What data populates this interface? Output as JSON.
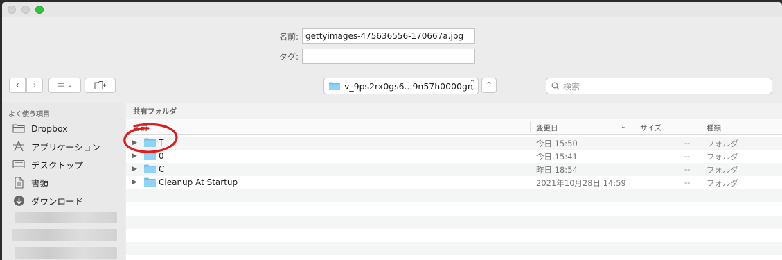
{
  "dialog": {
    "name_label": "名前:",
    "name_value": "gettyimages-475636556-170667a.jpg",
    "tag_label": "タグ:",
    "tag_value": ""
  },
  "toolbar": {
    "back_glyph": "‹",
    "forward_glyph": "›",
    "view_glyph": "≡",
    "view_chevron": "⌄",
    "location": "v_9ps2rx0gs6...9n57h0000gn",
    "collapse_glyph": "⌃",
    "search_placeholder": "検索"
  },
  "sidebar": {
    "heading": "よく使う項目",
    "items": [
      {
        "label": "Dropbox",
        "icon": "folder-icon"
      },
      {
        "label": "アプリケーション",
        "icon": "applications-icon"
      },
      {
        "label": "デスクトップ",
        "icon": "desktop-icon"
      },
      {
        "label": "書類",
        "icon": "documents-icon"
      },
      {
        "label": "ダウンロード",
        "icon": "download-icon"
      }
    ]
  },
  "browser": {
    "path_title": "共有フォルダ",
    "columns": {
      "name": "名前",
      "date": "変更日",
      "size": "サイズ",
      "kind": "種類"
    },
    "rows": [
      {
        "name": "T",
        "date": "今日 15:50",
        "size": "--",
        "kind": "フォルダ"
      },
      {
        "name": "0",
        "date": "今日 15:41",
        "size": "--",
        "kind": "フォルダ"
      },
      {
        "name": "C",
        "date": "昨日 18:54",
        "size": "--",
        "kind": "フォルダ"
      },
      {
        "name": "Cleanup At Startup",
        "date": "2021年10月28日 14:59",
        "size": "--",
        "kind": "フォルダ"
      }
    ]
  },
  "colors": {
    "folder_blue": "#6cc3f0",
    "annotation_red": "#e01b1b",
    "zoom_green": "#2ec640"
  }
}
